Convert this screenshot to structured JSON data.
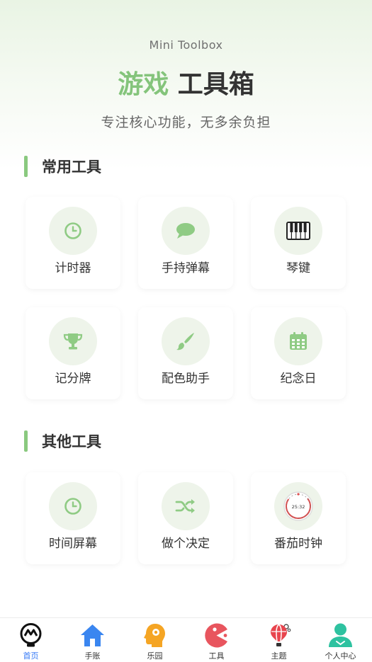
{
  "header": {
    "subtitle_en": "Mini Toolbox",
    "title_accent": "游戏",
    "title_main": "工具箱",
    "tagline": "专注核心功能，无多余负担"
  },
  "sections": [
    {
      "title": "常用工具",
      "tools": [
        {
          "label": "计时器",
          "icon": "clock-icon"
        },
        {
          "label": "手持弹幕",
          "icon": "chat-bubble-icon"
        },
        {
          "label": "琴键",
          "icon": "piano-icon"
        },
        {
          "label": "记分牌",
          "icon": "trophy-icon"
        },
        {
          "label": "配色助手",
          "icon": "paintbrush-icon"
        },
        {
          "label": "纪念日",
          "icon": "calendar-icon"
        }
      ]
    },
    {
      "title": "其他工具",
      "tools": [
        {
          "label": "时间屏幕",
          "icon": "clock-icon"
        },
        {
          "label": "做个决定",
          "icon": "shuffle-icon"
        },
        {
          "label": "番茄时钟",
          "icon": "pomodoro-timer-icon",
          "readout": "25:32"
        }
      ]
    }
  ],
  "tabbar": {
    "active": "首页",
    "tabs": [
      {
        "label": "首页",
        "icon": "home-lightbulb-icon"
      },
      {
        "label": "手账",
        "icon": "house-icon"
      },
      {
        "label": "乐园",
        "icon": "head-profile-icon"
      },
      {
        "label": "工具",
        "icon": "pacman-icon"
      },
      {
        "label": "主题",
        "icon": "hot-air-balloon-icon"
      },
      {
        "label": "个人中心",
        "icon": "user-icon"
      }
    ]
  },
  "colors": {
    "accent_green": "#84c47b",
    "icon_green": "#8fcb84",
    "active_blue": "#3478f6",
    "card_circle": "#eef4ea"
  }
}
